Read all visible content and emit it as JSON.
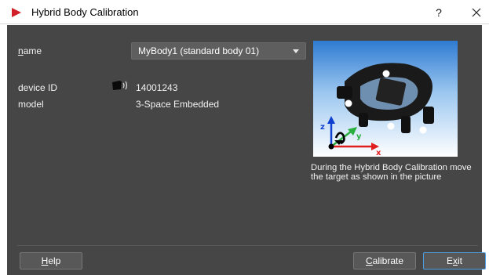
{
  "window": {
    "title": "Hybrid Body Calibration",
    "help_glyph": "?",
    "close_glyph": "✕"
  },
  "form": {
    "name_label_mnemonic": "n",
    "name_label_rest": "ame",
    "name_value": "MyBody1 (standard body 01)",
    "device_id_label": "device ID",
    "device_id_value": "14001243",
    "model_label": "model",
    "model_value": "3-Space Embedded"
  },
  "illustration": {
    "axis_z": "z",
    "axis_y": "y",
    "axis_x": "x",
    "caption": "During the Hybrid Body Calibration move the target as shown in the picture"
  },
  "buttons": {
    "help_mnemonic": "H",
    "help_rest": "elp",
    "calibrate_mnemonic": "C",
    "calibrate_rest": "alibrate",
    "exit_pre": "E",
    "exit_mnemonic": "x",
    "exit_rest": "it"
  },
  "icons": {
    "app": "red-play-triangle-icon",
    "help": "question-mark-icon",
    "close": "close-icon",
    "sensor": "wireless-sensor-icon",
    "dropdown": "chevron-down-icon"
  },
  "colors": {
    "dialog_bg": "#464646",
    "accent": "#4ea0e6",
    "app_icon": "#d0202a"
  }
}
